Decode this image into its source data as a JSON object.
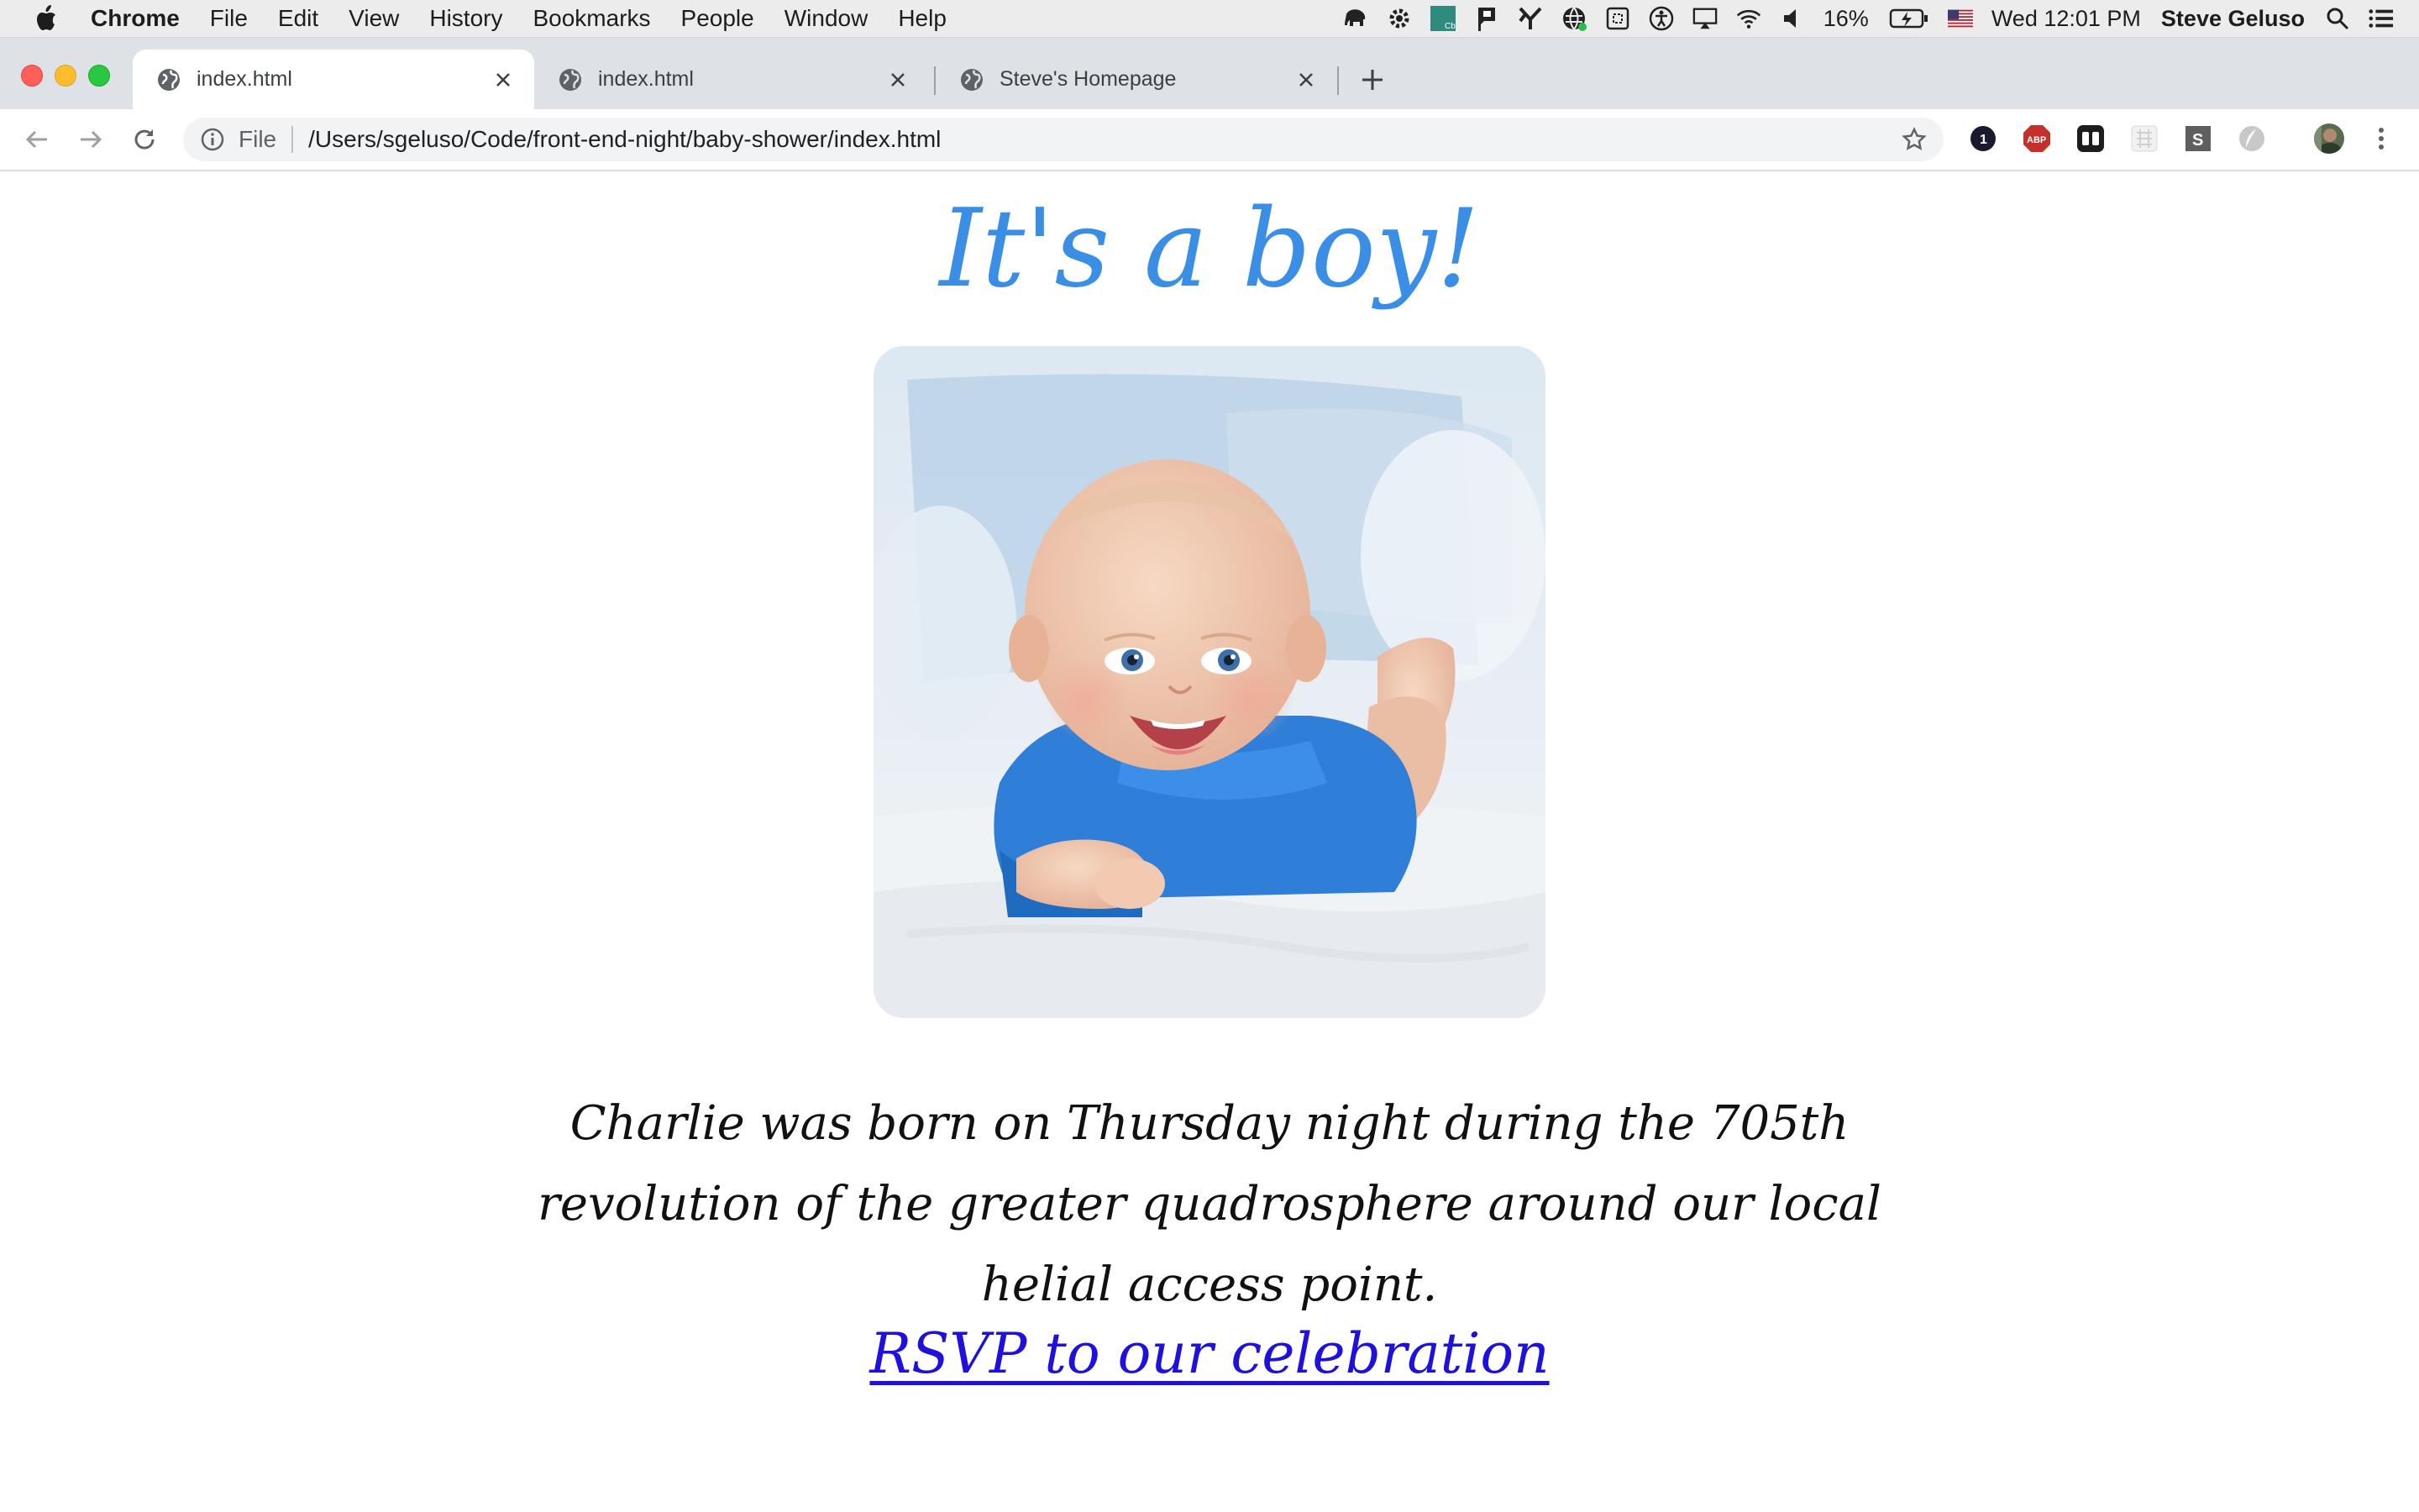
{
  "menubar": {
    "app_name": "Chrome",
    "items": [
      "File",
      "Edit",
      "View",
      "History",
      "Bookmarks",
      "People",
      "Window",
      "Help"
    ],
    "battery": "16%",
    "clock": "Wed 12:01 PM",
    "user": "Steve Geluso"
  },
  "tabs": [
    {
      "title": "index.html",
      "active": true
    },
    {
      "title": "index.html",
      "active": false
    },
    {
      "title": "Steve's Homepage",
      "active": false
    }
  ],
  "toolbar": {
    "scheme_label": "File",
    "url": "/Users/sgeluso/Code/front-end-night/baby-shower/index.html"
  },
  "page": {
    "heading": "It's a boy!",
    "body": "Charlie was born on Thursday night during the 705th revolution of the greater quadrosphere around our local helial access point.",
    "rsvp_link": "RSVP to our celebration"
  },
  "colors": {
    "heading": "#3b8ee6",
    "link": "#1e10dd",
    "onesie": "#2f7fd8"
  },
  "icons": {
    "extensions": [
      "1password-icon",
      "adblock-icon",
      "tweetdeck-icon",
      "grid-extension-icon",
      "s-extension-icon",
      "feather-extension-icon"
    ]
  }
}
